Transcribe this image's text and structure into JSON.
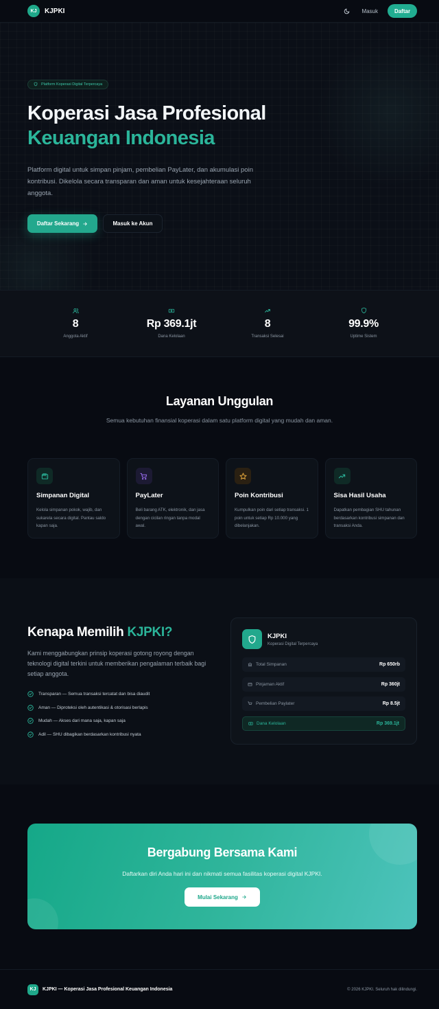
{
  "nav": {
    "logo_text": "KJ",
    "brand": "KJPKI",
    "theme_icon": "moon-icon",
    "login": "Masuk",
    "register": "Daftar"
  },
  "hero": {
    "badge": "Platform Koperasi Digital Terpercaya",
    "title_line1": "Koperasi Jasa Profesional",
    "title_line2": "Keuangan Indonesia",
    "description": "Platform digital untuk simpan pinjam, pembelian PayLater, dan akumulasi poin kontribusi. Dikelola secara transparan dan aman untuk kesejahteraan seluruh anggota.",
    "primary_button": "Daftar Sekarang",
    "secondary_button": "Masuk ke Akun"
  },
  "stats": [
    {
      "icon": "users-icon",
      "value": "8",
      "label": "Anggota Aktif"
    },
    {
      "icon": "banknote-icon",
      "value": "Rp 369.1jt",
      "label": "Dana Kelolaan"
    },
    {
      "icon": "trending-up-icon",
      "value": "8",
      "label": "Transaksi Selesai"
    },
    {
      "icon": "shield-icon",
      "value": "99.9%",
      "label": "Uptime Sistem"
    }
  ],
  "services": {
    "title": "Layanan Unggulan",
    "subtitle": "Semua kebutuhan finansial koperasi dalam satu platform digital yang mudah dan aman.",
    "cards": [
      {
        "icon": "wallet-icon",
        "title": "Simpanan Digital",
        "desc": "Kelola simpanan pokok, wajib, dan sukarela secara digital. Pantau saldo kapan saja."
      },
      {
        "icon": "cart-icon",
        "title": "PayLater",
        "desc": "Beli barang ATK, elektronik, dan jasa dengan cicilan ringan tanpa modal awal."
      },
      {
        "icon": "star-icon",
        "title": "Poin Kontribusi",
        "desc": "Kumpulkan poin dari setiap transaksi. 1 poin untuk setiap Rp 10.000 yang dibelanjakan."
      },
      {
        "icon": "trending-up-icon",
        "title": "Sisa Hasil Usaha",
        "desc": "Dapatkan pembagian SHU tahunan berdasarkan kontribusi simpanan dan transaksi Anda."
      }
    ]
  },
  "why": {
    "title_prefix": "Kenapa Memilih ",
    "title_highlight": "KJPKI?",
    "description": "Kami menggabungkan prinsip koperasi gotong royong dengan teknologi digital terkini untuk memberikan pengalaman terbaik bagi setiap anggota.",
    "points": [
      "Transparan — Semua transaksi tercatat dan bisa diaudit",
      "Aman — Diproteksi oleh autentikasi & otorisasi berlapis",
      "Mudah — Akses dari mana saja, kapan saja",
      "Adil — SHU dibagikan berdasarkan kontribusi nyata"
    ],
    "panel": {
      "name": "KJPKI",
      "tagline": "Koperasi Digital Terpercaya",
      "rows": [
        {
          "icon": "bank-icon",
          "label": "Total Simpanan",
          "value": "Rp 650rb"
        },
        {
          "icon": "card-icon",
          "label": "Pinjaman Aktif",
          "value": "Rp 360jt"
        },
        {
          "icon": "cart-icon",
          "label": "Pembelian Paylater",
          "value": "Rp 8.5jt"
        },
        {
          "icon": "banknote-icon",
          "label": "Dana Kelolaan",
          "value": "Rp 369.1jt"
        }
      ]
    }
  },
  "cta": {
    "title": "Bergabung Bersama Kami",
    "subtitle": "Daftarkan diri Anda hari ini dan nikmati semua fasilitas koperasi digital KJPKI.",
    "button": "Mulai Sekarang"
  },
  "footer": {
    "logo_text": "KJ",
    "brand": "KJPKI — Koperasi Jasa Profesional Keuangan Indonesia",
    "copyright": "© 2026 KJPKI. Seluruh hak dilindungi."
  },
  "colors": {
    "accent": "#21ad91",
    "background": "#080b12"
  }
}
